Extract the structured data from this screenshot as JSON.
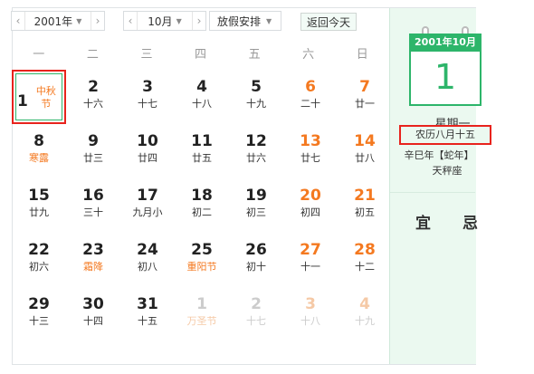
{
  "toolbar": {
    "prev_icon": "chevron-left-icon",
    "next_icon": "chevron-right-icon",
    "year": "2001年",
    "month": "10月",
    "holiday": "放假安排",
    "today": "返回今天"
  },
  "weekdays": [
    "一",
    "二",
    "三",
    "四",
    "五",
    "六",
    "日"
  ],
  "weeks": [
    [
      {
        "d": "1",
        "l": "中秋节",
        "t": "fest sel"
      },
      {
        "d": "2",
        "l": "十六"
      },
      {
        "d": "3",
        "l": "十七"
      },
      {
        "d": "4",
        "l": "十八"
      },
      {
        "d": "5",
        "l": "十九"
      },
      {
        "d": "6",
        "l": "二十",
        "t": "we"
      },
      {
        "d": "7",
        "l": "廿一",
        "t": "we"
      }
    ],
    [
      {
        "d": "8",
        "l": "寒露",
        "t": "fest"
      },
      {
        "d": "9",
        "l": "廿三"
      },
      {
        "d": "10",
        "l": "廿四"
      },
      {
        "d": "11",
        "l": "廿五"
      },
      {
        "d": "12",
        "l": "廿六"
      },
      {
        "d": "13",
        "l": "廿七",
        "t": "we"
      },
      {
        "d": "14",
        "l": "廿八",
        "t": "we"
      }
    ],
    [
      {
        "d": "15",
        "l": "廿九"
      },
      {
        "d": "16",
        "l": "三十"
      },
      {
        "d": "17",
        "l": "九月小"
      },
      {
        "d": "18",
        "l": "初二"
      },
      {
        "d": "19",
        "l": "初三"
      },
      {
        "d": "20",
        "l": "初四",
        "t": "we"
      },
      {
        "d": "21",
        "l": "初五",
        "t": "we"
      }
    ],
    [
      {
        "d": "22",
        "l": "初六"
      },
      {
        "d": "23",
        "l": "霜降",
        "t": "fest"
      },
      {
        "d": "24",
        "l": "初八"
      },
      {
        "d": "25",
        "l": "重阳节",
        "t": "fest"
      },
      {
        "d": "26",
        "l": "初十"
      },
      {
        "d": "27",
        "l": "十一",
        "t": "we"
      },
      {
        "d": "28",
        "l": "十二",
        "t": "we"
      }
    ],
    [
      {
        "d": "29",
        "l": "十三"
      },
      {
        "d": "30",
        "l": "十四"
      },
      {
        "d": "31",
        "l": "十五"
      },
      {
        "d": "1",
        "l": "万圣节",
        "t": "other fest"
      },
      {
        "d": "2",
        "l": "十七",
        "t": "other"
      },
      {
        "d": "3",
        "l": "十八",
        "t": "other we"
      },
      {
        "d": "4",
        "l": "十九",
        "t": "other we"
      }
    ]
  ],
  "panel": {
    "header": "2001年10月",
    "day": "1",
    "weekday": "星期一",
    "lunar": "农历八月十五",
    "ganzhi": "辛巳年【蛇年】",
    "constellation": "天秤座",
    "yi": "宜",
    "ji": "忌"
  },
  "colors": {
    "accent": "#2db56a",
    "weekend": "#f47920",
    "highlight": "#e8231d"
  }
}
